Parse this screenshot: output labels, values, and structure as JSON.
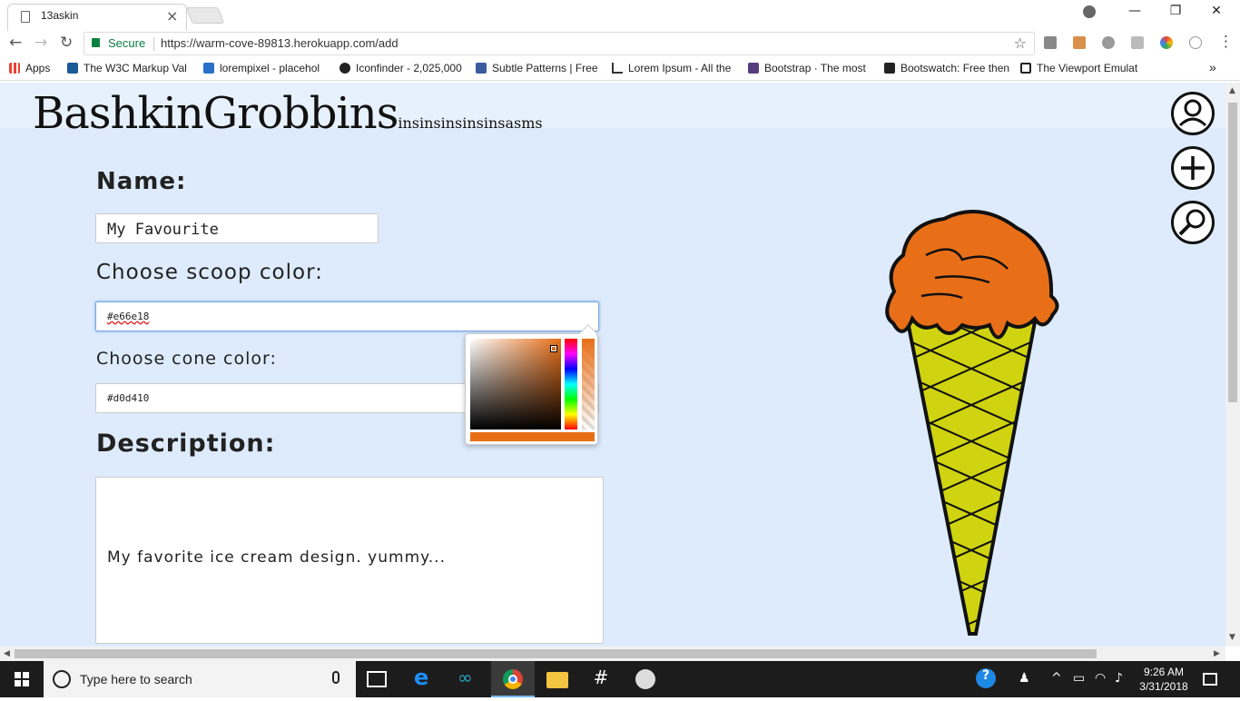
{
  "browser": {
    "tab_title": "13askin",
    "secure_label": "Secure",
    "url": "https://warm-cove-89813.herokuapp.com/add",
    "bookmarks": [
      {
        "label": "Apps",
        "icon": "apps-grid-icon",
        "color": "#e94235"
      },
      {
        "label": "The W3C Markup Val",
        "icon": "w3c-icon",
        "color": "#1a5a96"
      },
      {
        "label": "lorempixel - placehol",
        "icon": "lorempixel-icon",
        "color": "#2a6fc9"
      },
      {
        "label": "Iconfinder - 2,025,000",
        "icon": "iconfinder-icon",
        "color": "#222222"
      },
      {
        "label": "Subtle Patterns | Free",
        "icon": "subtle-patterns-icon",
        "color": "#3b5c9c"
      },
      {
        "label": "Lorem Ipsum - All the",
        "icon": "lorem-ipsum-icon",
        "color": "#333333"
      },
      {
        "label": "Bootstrap · The most",
        "icon": "bootstrap-icon",
        "color": "#563d7c"
      },
      {
        "label": "Bootswatch: Free then",
        "icon": "bootswatch-icon",
        "color": "#222222"
      },
      {
        "label": "The Viewport Emulat",
        "icon": "viewport-emulator-icon",
        "color": "#222222"
      }
    ],
    "more_bookmarks": "»"
  },
  "page": {
    "brand": "BashkinGrobbins",
    "brand_tail": "insinsinsinsinsasms",
    "name_label": "Name:",
    "name_value": "My Favourite",
    "scoop_label": "Choose scoop color:",
    "scoop_value": "#e66e18",
    "cone_label": "Choose cone color:",
    "cone_value": "#d0d410",
    "description_label": "Description:",
    "description_value": "My favorite ice cream design. yummy...",
    "nav_icons": [
      "profile-icon",
      "add-icon",
      "search-icon"
    ],
    "scoop_color": "#e86f18",
    "cone_color": "#d0d410"
  },
  "taskbar": {
    "search_placeholder": "Type here to search",
    "time": "9:26 AM",
    "date": "3/31/2018"
  }
}
